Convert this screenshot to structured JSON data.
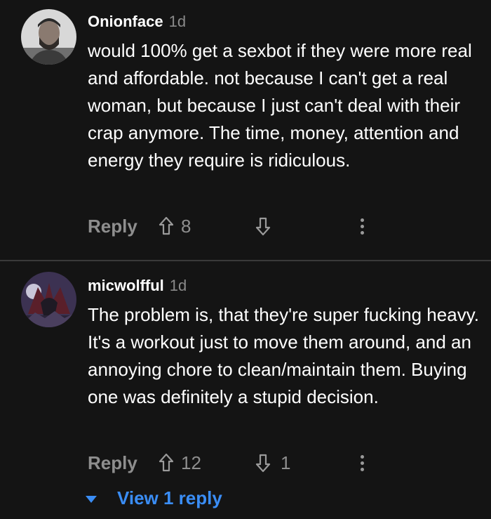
{
  "comments": [
    {
      "username": "Onionface",
      "age": "1d",
      "body": "would 100% get a sexbot if they were more real and affordable. not because I can't get a real woman, but because I just can't deal with their crap anymore. The time, money, attention and energy they require is ridiculous.",
      "reply_label": "Reply",
      "upvotes": "8",
      "downvotes": ""
    },
    {
      "username": "micwolfful",
      "age": "1d",
      "body": "The problem is, that they're super fucking heavy. It's a workout just to move them around, and an annoying chore to clean/maintain them. Buying one was definitely a stupid decision.",
      "reply_label": "Reply",
      "upvotes": "12",
      "downvotes": "1",
      "view_replies_label": "View 1 reply"
    }
  ],
  "icons": {
    "upvote": "arrow-up-outline-icon",
    "downvote": "arrow-down-outline-icon",
    "more": "vertical-ellipsis-icon",
    "expand": "caret-down-icon"
  },
  "colors": {
    "background": "#141414",
    "text_primary": "#ffffff",
    "text_secondary": "#8e8e8e",
    "accent_link": "#3a8df5",
    "divider": "#3a3a3a"
  }
}
